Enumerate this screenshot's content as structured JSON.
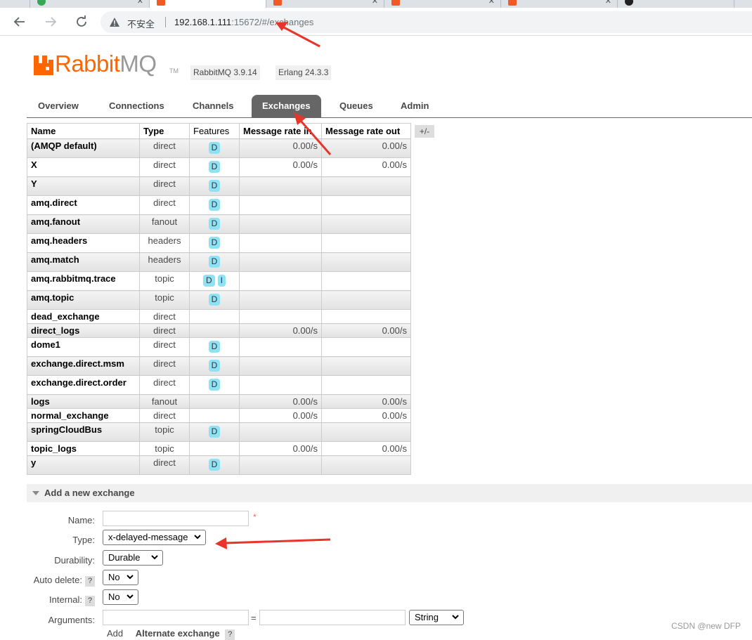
{
  "browser": {
    "security_label": "不安全",
    "url_host": "192.168.1.111",
    "url_port": ":15672/",
    "url_path": "#/exchanges"
  },
  "app": {
    "brand_rabbit": "Rabbit",
    "brand_mq": "MQ",
    "tm": "TM",
    "version": "RabbitMQ 3.9.14",
    "erlang": "Erlang 24.3.3"
  },
  "nav_tabs": [
    "Overview",
    "Connections",
    "Channels",
    "Exchanges",
    "Queues",
    "Admin"
  ],
  "active_tab": "Exchanges",
  "table": {
    "headers": [
      "Name",
      "Type",
      "Features",
      "Message rate in",
      "Message rate out"
    ],
    "toggle_columns": "+/-",
    "rows": [
      {
        "name": "(AMQP default)",
        "type": "direct",
        "features": [
          "D"
        ],
        "rate_in": "0.00/s",
        "rate_out": "0.00/s"
      },
      {
        "name": "X",
        "type": "direct",
        "features": [
          "D"
        ],
        "rate_in": "0.00/s",
        "rate_out": "0.00/s"
      },
      {
        "name": "Y",
        "type": "direct",
        "features": [
          "D"
        ],
        "rate_in": "",
        "rate_out": ""
      },
      {
        "name": "amq.direct",
        "type": "direct",
        "features": [
          "D"
        ],
        "rate_in": "",
        "rate_out": ""
      },
      {
        "name": "amq.fanout",
        "type": "fanout",
        "features": [
          "D"
        ],
        "rate_in": "",
        "rate_out": ""
      },
      {
        "name": "amq.headers",
        "type": "headers",
        "features": [
          "D"
        ],
        "rate_in": "",
        "rate_out": ""
      },
      {
        "name": "amq.match",
        "type": "headers",
        "features": [
          "D"
        ],
        "rate_in": "",
        "rate_out": ""
      },
      {
        "name": "amq.rabbitmq.trace",
        "type": "topic",
        "features": [
          "D",
          "I"
        ],
        "rate_in": "",
        "rate_out": ""
      },
      {
        "name": "amq.topic",
        "type": "topic",
        "features": [
          "D"
        ],
        "rate_in": "",
        "rate_out": ""
      },
      {
        "name": "dead_exchange",
        "type": "direct",
        "features": [],
        "rate_in": "",
        "rate_out": ""
      },
      {
        "name": "direct_logs",
        "type": "direct",
        "features": [],
        "rate_in": "0.00/s",
        "rate_out": "0.00/s"
      },
      {
        "name": "dome1",
        "type": "direct",
        "features": [
          "D"
        ],
        "rate_in": "",
        "rate_out": ""
      },
      {
        "name": "exchange.direct.msm",
        "type": "direct",
        "features": [
          "D"
        ],
        "rate_in": "",
        "rate_out": ""
      },
      {
        "name": "exchange.direct.order",
        "type": "direct",
        "features": [
          "D"
        ],
        "rate_in": "",
        "rate_out": ""
      },
      {
        "name": "logs",
        "type": "fanout",
        "features": [],
        "rate_in": "0.00/s",
        "rate_out": "0.00/s"
      },
      {
        "name": "normal_exchange",
        "type": "direct",
        "features": [],
        "rate_in": "0.00/s",
        "rate_out": "0.00/s"
      },
      {
        "name": "springCloudBus",
        "type": "topic",
        "features": [
          "D"
        ],
        "rate_in": "",
        "rate_out": ""
      },
      {
        "name": "topic_logs",
        "type": "topic",
        "features": [],
        "rate_in": "0.00/s",
        "rate_out": "0.00/s"
      },
      {
        "name": "y",
        "type": "direct",
        "features": [
          "D"
        ],
        "rate_in": "",
        "rate_out": ""
      }
    ]
  },
  "add_exchange": {
    "section_title": "Add a new exchange",
    "name_label": "Name:",
    "name_value": "",
    "required_mark": "*",
    "type_label": "Type:",
    "type_value": "x-delayed-message",
    "durability_label": "Durability:",
    "durability_value": "Durable",
    "auto_delete_label": "Auto delete:",
    "auto_delete_value": "No",
    "internal_label": "Internal:",
    "internal_value": "No",
    "arguments_label": "Arguments:",
    "arguments_equals": "=",
    "arguments_type_value": "String",
    "help_mark": "?",
    "add_link": "Add",
    "alternate_exchange": "Alternate exchange"
  },
  "watermark": "CSDN @new DFP",
  "colors": {
    "brand_orange": "#ff6600",
    "active_tab_bg": "#666666",
    "feature_badge": "#8ee2f6",
    "annotation_arrow": "#e8352b"
  }
}
